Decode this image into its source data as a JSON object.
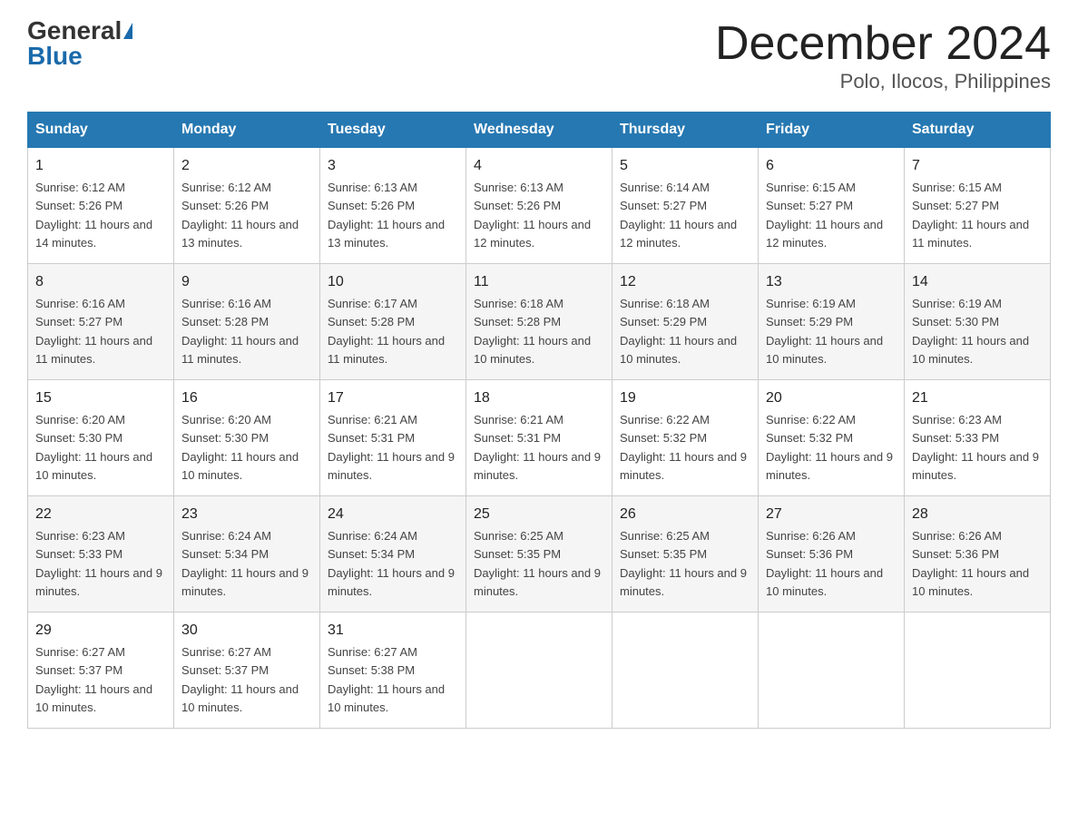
{
  "header": {
    "logo_general": "General",
    "logo_blue": "Blue",
    "title": "December 2024",
    "subtitle": "Polo, Ilocos, Philippines"
  },
  "weekdays": [
    "Sunday",
    "Monday",
    "Tuesday",
    "Wednesday",
    "Thursday",
    "Friday",
    "Saturday"
  ],
  "weeks": [
    [
      {
        "day": "1",
        "sunrise": "6:12 AM",
        "sunset": "5:26 PM",
        "daylight": "11 hours and 14 minutes."
      },
      {
        "day": "2",
        "sunrise": "6:12 AM",
        "sunset": "5:26 PM",
        "daylight": "11 hours and 13 minutes."
      },
      {
        "day": "3",
        "sunrise": "6:13 AM",
        "sunset": "5:26 PM",
        "daylight": "11 hours and 13 minutes."
      },
      {
        "day": "4",
        "sunrise": "6:13 AM",
        "sunset": "5:26 PM",
        "daylight": "11 hours and 12 minutes."
      },
      {
        "day": "5",
        "sunrise": "6:14 AM",
        "sunset": "5:27 PM",
        "daylight": "11 hours and 12 minutes."
      },
      {
        "day": "6",
        "sunrise": "6:15 AM",
        "sunset": "5:27 PM",
        "daylight": "11 hours and 12 minutes."
      },
      {
        "day": "7",
        "sunrise": "6:15 AM",
        "sunset": "5:27 PM",
        "daylight": "11 hours and 11 minutes."
      }
    ],
    [
      {
        "day": "8",
        "sunrise": "6:16 AM",
        "sunset": "5:27 PM",
        "daylight": "11 hours and 11 minutes."
      },
      {
        "day": "9",
        "sunrise": "6:16 AM",
        "sunset": "5:28 PM",
        "daylight": "11 hours and 11 minutes."
      },
      {
        "day": "10",
        "sunrise": "6:17 AM",
        "sunset": "5:28 PM",
        "daylight": "11 hours and 11 minutes."
      },
      {
        "day": "11",
        "sunrise": "6:18 AM",
        "sunset": "5:28 PM",
        "daylight": "11 hours and 10 minutes."
      },
      {
        "day": "12",
        "sunrise": "6:18 AM",
        "sunset": "5:29 PM",
        "daylight": "11 hours and 10 minutes."
      },
      {
        "day": "13",
        "sunrise": "6:19 AM",
        "sunset": "5:29 PM",
        "daylight": "11 hours and 10 minutes."
      },
      {
        "day": "14",
        "sunrise": "6:19 AM",
        "sunset": "5:30 PM",
        "daylight": "11 hours and 10 minutes."
      }
    ],
    [
      {
        "day": "15",
        "sunrise": "6:20 AM",
        "sunset": "5:30 PM",
        "daylight": "11 hours and 10 minutes."
      },
      {
        "day": "16",
        "sunrise": "6:20 AM",
        "sunset": "5:30 PM",
        "daylight": "11 hours and 10 minutes."
      },
      {
        "day": "17",
        "sunrise": "6:21 AM",
        "sunset": "5:31 PM",
        "daylight": "11 hours and 9 minutes."
      },
      {
        "day": "18",
        "sunrise": "6:21 AM",
        "sunset": "5:31 PM",
        "daylight": "11 hours and 9 minutes."
      },
      {
        "day": "19",
        "sunrise": "6:22 AM",
        "sunset": "5:32 PM",
        "daylight": "11 hours and 9 minutes."
      },
      {
        "day": "20",
        "sunrise": "6:22 AM",
        "sunset": "5:32 PM",
        "daylight": "11 hours and 9 minutes."
      },
      {
        "day": "21",
        "sunrise": "6:23 AM",
        "sunset": "5:33 PM",
        "daylight": "11 hours and 9 minutes."
      }
    ],
    [
      {
        "day": "22",
        "sunrise": "6:23 AM",
        "sunset": "5:33 PM",
        "daylight": "11 hours and 9 minutes."
      },
      {
        "day": "23",
        "sunrise": "6:24 AM",
        "sunset": "5:34 PM",
        "daylight": "11 hours and 9 minutes."
      },
      {
        "day": "24",
        "sunrise": "6:24 AM",
        "sunset": "5:34 PM",
        "daylight": "11 hours and 9 minutes."
      },
      {
        "day": "25",
        "sunrise": "6:25 AM",
        "sunset": "5:35 PM",
        "daylight": "11 hours and 9 minutes."
      },
      {
        "day": "26",
        "sunrise": "6:25 AM",
        "sunset": "5:35 PM",
        "daylight": "11 hours and 9 minutes."
      },
      {
        "day": "27",
        "sunrise": "6:26 AM",
        "sunset": "5:36 PM",
        "daylight": "11 hours and 10 minutes."
      },
      {
        "day": "28",
        "sunrise": "6:26 AM",
        "sunset": "5:36 PM",
        "daylight": "11 hours and 10 minutes."
      }
    ],
    [
      {
        "day": "29",
        "sunrise": "6:27 AM",
        "sunset": "5:37 PM",
        "daylight": "11 hours and 10 minutes."
      },
      {
        "day": "30",
        "sunrise": "6:27 AM",
        "sunset": "5:37 PM",
        "daylight": "11 hours and 10 minutes."
      },
      {
        "day": "31",
        "sunrise": "6:27 AM",
        "sunset": "5:38 PM",
        "daylight": "11 hours and 10 minutes."
      },
      null,
      null,
      null,
      null
    ]
  ]
}
